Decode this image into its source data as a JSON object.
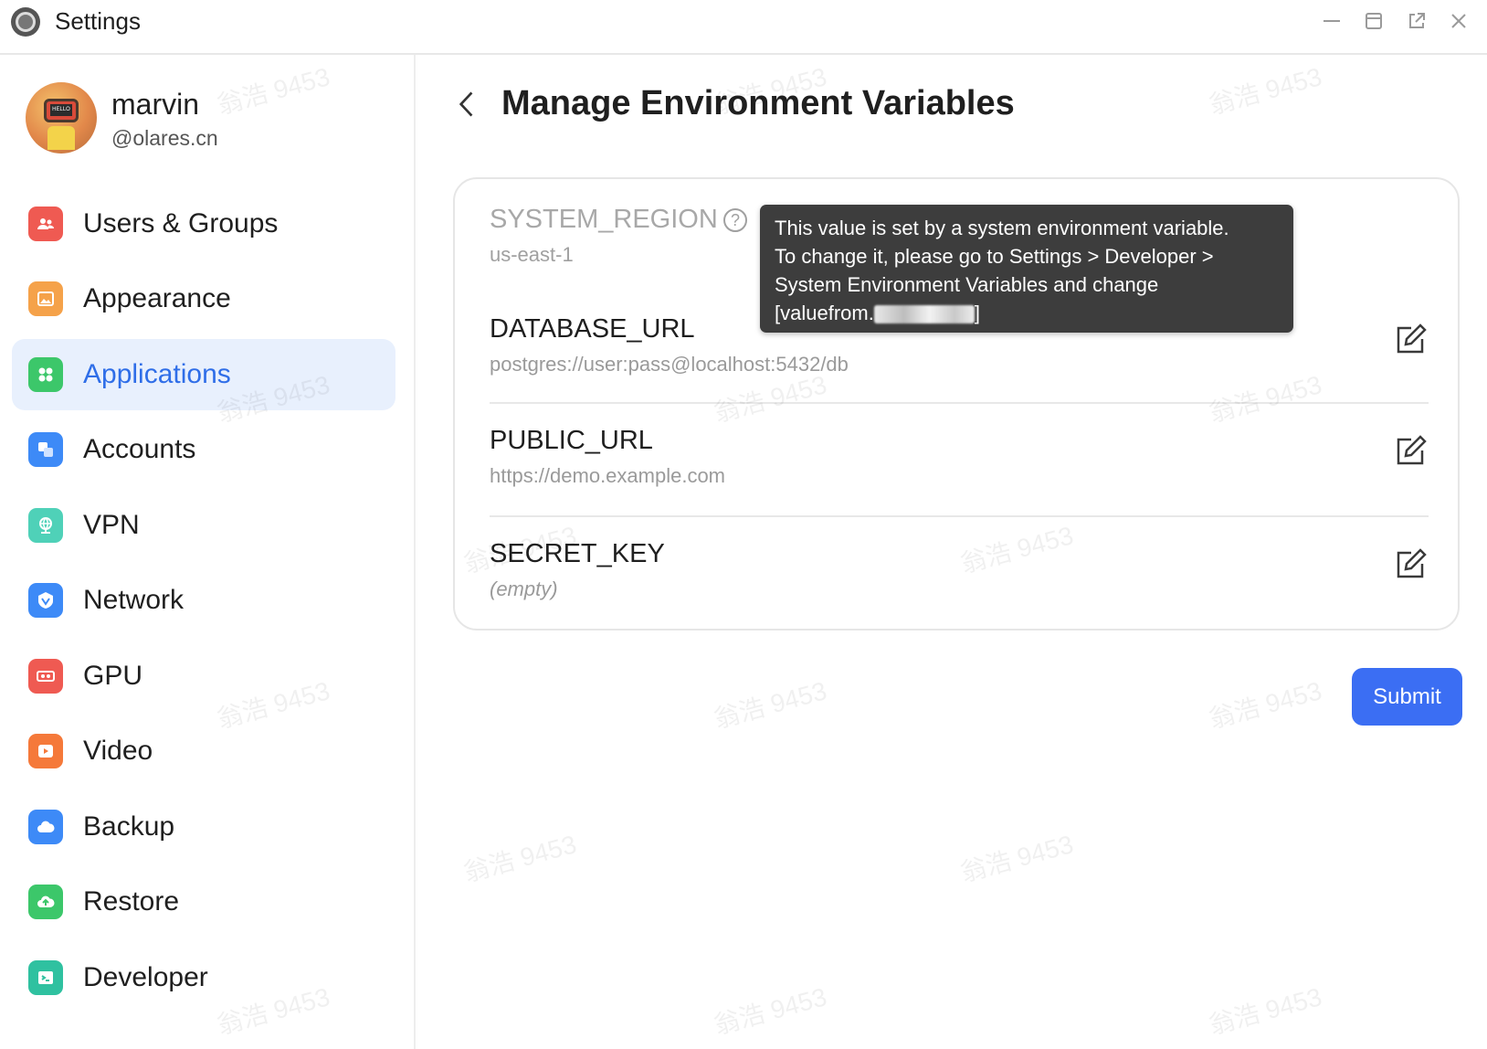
{
  "window": {
    "title": "Settings"
  },
  "profile": {
    "name": "marvin",
    "handle": "@olares.cn",
    "avatar_text": "HELLO"
  },
  "sidebar": {
    "items": [
      {
        "label": "Users & Groups",
        "icon": "users-icon",
        "color": "#ef5a52",
        "active": false
      },
      {
        "label": "Appearance",
        "icon": "image-icon",
        "color": "#f5a24a",
        "active": false
      },
      {
        "label": "Applications",
        "icon": "apps-grid-icon",
        "color": "#3cc76a",
        "active": true
      },
      {
        "label": "Accounts",
        "icon": "accounts-icon",
        "color": "#3d8af7",
        "active": false
      },
      {
        "label": "VPN",
        "icon": "globe-icon",
        "color": "#4fd1b8",
        "active": false
      },
      {
        "label": "Network",
        "icon": "network-icon",
        "color": "#3d8af7",
        "active": false
      },
      {
        "label": "GPU",
        "icon": "gpu-icon",
        "color": "#ef5a52",
        "active": false
      },
      {
        "label": "Video",
        "icon": "play-icon",
        "color": "#f5793a",
        "active": false
      },
      {
        "label": "Backup",
        "icon": "cloud-icon",
        "color": "#3d8af7",
        "active": false
      },
      {
        "label": "Restore",
        "icon": "cloud-restore-icon",
        "color": "#3cc76a",
        "active": false
      },
      {
        "label": "Developer",
        "icon": "terminal-icon",
        "color": "#2fc1a0",
        "active": false
      }
    ]
  },
  "main": {
    "title": "Manage Environment Variables",
    "variables": [
      {
        "name": "SYSTEM_REGION",
        "value": "us-east-1",
        "editable": false,
        "has_help": true
      },
      {
        "name": "DATABASE_URL",
        "value": "postgres://user:pass@localhost:5432/db",
        "editable": true
      },
      {
        "name": "PUBLIC_URL",
        "value": "https://demo.example.com",
        "editable": true
      },
      {
        "name": "SECRET_KEY",
        "value": "(empty)",
        "editable": true
      }
    ],
    "tooltip": {
      "line1": "This value is set by a system environment variable.",
      "line2": "To change it, please go to Settings > Developer >",
      "line3": "System Environment Variables and change",
      "line4_prefix": "[valuefrom.",
      "line4_suffix": "]"
    },
    "submit_label": "Submit"
  },
  "watermark_text": "翁浩 9453",
  "colors": {
    "accent": "#3b6ef3",
    "active_bg": "#e8f0fd",
    "active_text": "#2f6ee8"
  }
}
